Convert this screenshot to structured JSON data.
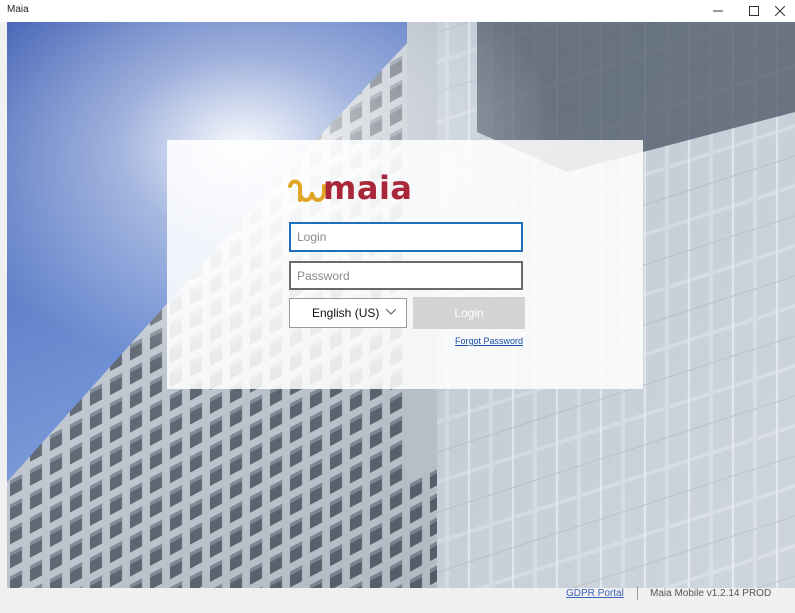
{
  "window": {
    "title": "Maia",
    "minimize_icon": "minimize-icon",
    "maximize_icon": "maximize-icon",
    "close_icon": "close-icon"
  },
  "logo": {
    "text": "maia",
    "brand_color": "#a8273a",
    "accent_color": "#e0a524"
  },
  "login_form": {
    "login_placeholder": "Login",
    "login_value": "",
    "password_placeholder": "Password",
    "password_value": "",
    "language_selected": "English (US)",
    "login_button": "Login",
    "forgot_password": "Forgot Password",
    "focus_color": "#1f6fbf"
  },
  "footer": {
    "gdpr_link": "GDPR Portal",
    "version": "Maia Mobile v1.2.14 PROD"
  }
}
